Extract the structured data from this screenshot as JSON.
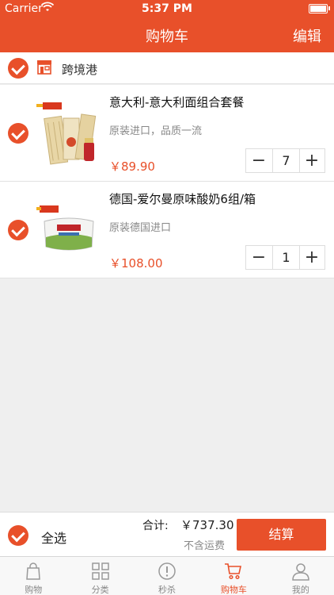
{
  "status_bar": {
    "carrier": "Carrier",
    "time": "5:37 PM"
  },
  "nav": {
    "title": "购物车",
    "edit_label": "编辑"
  },
  "store": {
    "name": "跨境港"
  },
  "items": [
    {
      "name": "意大利-意大利面组合套餐",
      "description": "原装进口，品质一流",
      "price": "￥89.90",
      "quantity": "7"
    },
    {
      "name": "德国-爱尔曼原味酸奶6组/箱",
      "description": "原装德国进口",
      "price": "￥108.00",
      "quantity": "1"
    }
  ],
  "summary": {
    "select_all_label": "全选",
    "total_label": "合计:",
    "total_value": "￥737.30",
    "shipping_note": "不含运费",
    "checkout_label": "结算"
  },
  "tabs": [
    {
      "label": "购物",
      "icon": "bag-icon"
    },
    {
      "label": "分类",
      "icon": "grid-icon"
    },
    {
      "label": "秒杀",
      "icon": "alert-circle-icon"
    },
    {
      "label": "购物车",
      "icon": "cart-icon",
      "active": true
    },
    {
      "label": "我的",
      "icon": "person-icon"
    }
  ],
  "colors": {
    "accent": "#e8502a",
    "background": "#efefef"
  }
}
